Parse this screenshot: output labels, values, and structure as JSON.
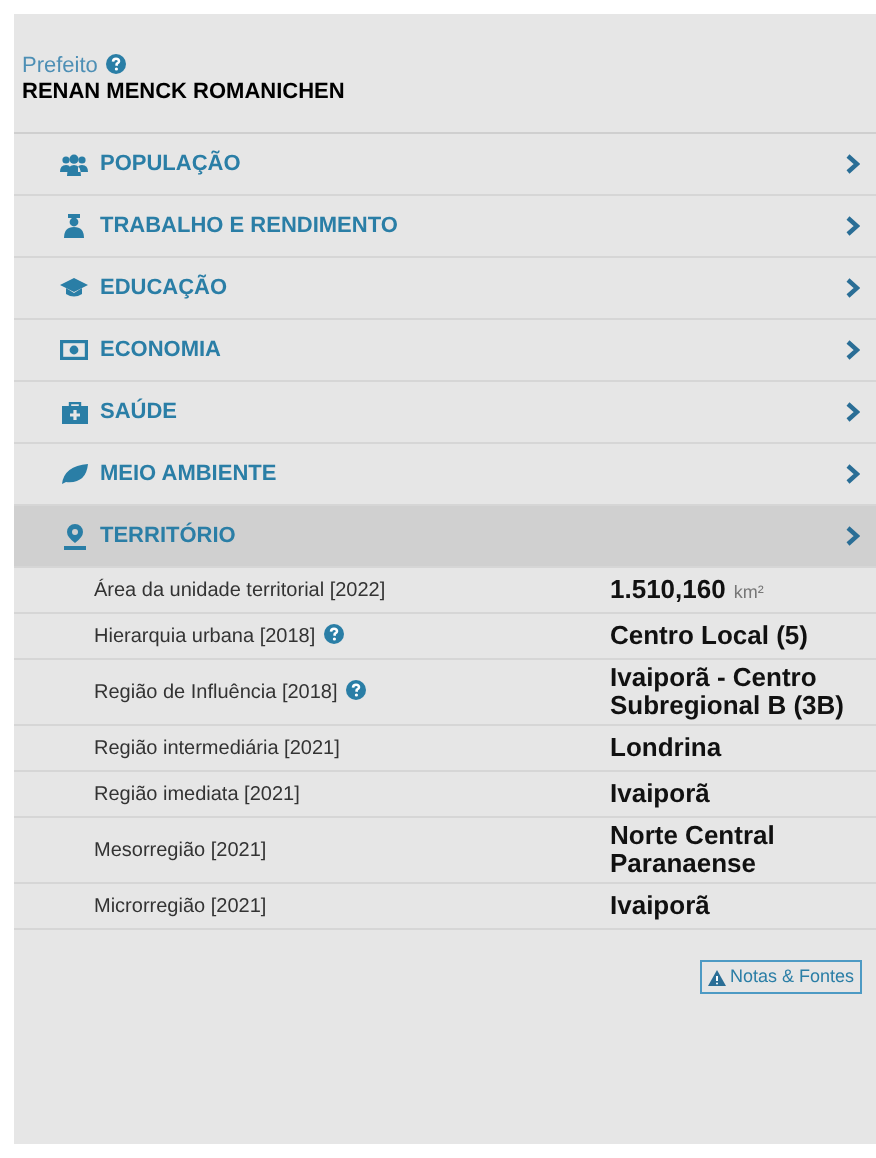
{
  "mayor": {
    "label": "Prefeito",
    "help": true,
    "name": "RENAN MENCK ROMANICHEN"
  },
  "categories": [
    {
      "label": "POPULAÇÃO",
      "expanded": false
    },
    {
      "label": "TRABALHO E RENDIMENTO",
      "expanded": false
    },
    {
      "label": "EDUCAÇÃO",
      "expanded": false
    },
    {
      "label": "ECONOMIA",
      "expanded": false
    },
    {
      "label": "SAÚDE",
      "expanded": false
    },
    {
      "label": "MEIO AMBIENTE",
      "expanded": false
    },
    {
      "label": "TERRITÓRIO",
      "expanded": true
    }
  ],
  "territory_rows": [
    {
      "label": "Área da unidade territorial [2022]",
      "help": false,
      "value": "1.510,160",
      "unit": "km²"
    },
    {
      "label": "Hierarquia urbana [2018]",
      "help": true,
      "value": "Centro Local (5)"
    },
    {
      "label": "Região de Influência [2018]",
      "help": true,
      "value": "Ivaiporã - Centro Subregional B (3B)"
    },
    {
      "label": "Região intermediária [2021]",
      "help": false,
      "value": "Londrina"
    },
    {
      "label": "Região imediata [2021]",
      "help": false,
      "value": "Ivaiporã"
    },
    {
      "label": "Mesorregião [2021]",
      "help": false,
      "value": "Norte Central Paranaense"
    },
    {
      "label": "Microrregião [2021]",
      "help": false,
      "value": "Ivaiporã"
    }
  ],
  "notes_button": "Notas & Fontes"
}
